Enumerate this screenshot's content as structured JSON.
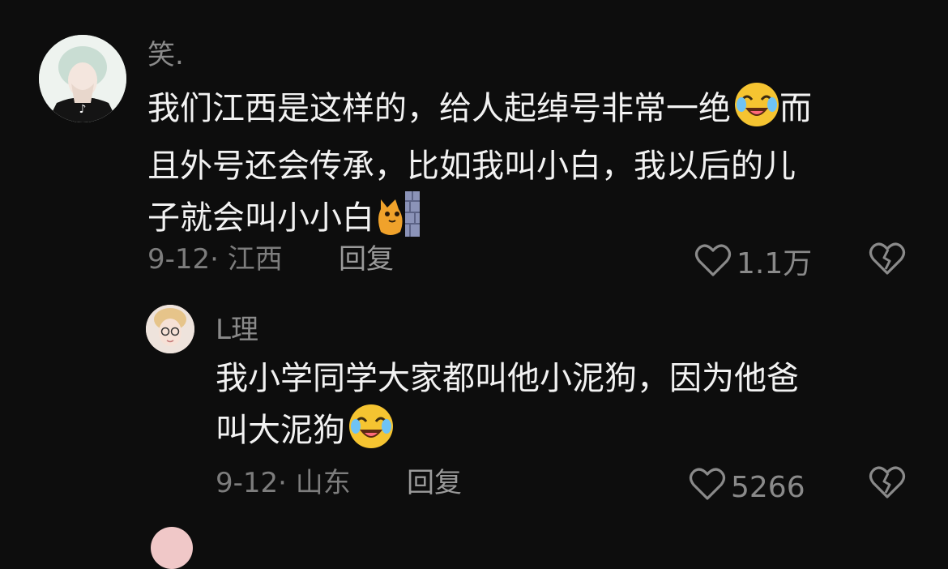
{
  "comments": [
    {
      "author": "笑.",
      "text_lines": [
        "我们江西是这样的，给人起绰号非常一绝",
        "而",
        "且外号还会传承，比如我叫小白，我以后的儿",
        "子就会叫小小白"
      ],
      "date": "9-12",
      "location": "江西",
      "reply_label": "回复",
      "likes": "1.1万",
      "emoji_1": "crying-laughing-emoji",
      "emoji_2": "cat-peeking-wall-sticker"
    }
  ],
  "replies": [
    {
      "author": "L理",
      "text_lines": [
        "我小学同学大家都叫他小泥狗，因为他爸",
        "叫大泥狗"
      ],
      "date": "9-12",
      "location": "山东",
      "reply_label": "回复",
      "likes": "5266",
      "emoji_1": "crying-laughing-emoji"
    }
  ],
  "colors": {
    "background": "#0d0d0d",
    "primary_text": "#f2f2f2",
    "secondary_text": "#8a8a8a",
    "emoji_yellow": "#f5c431"
  },
  "icons": [
    "heart-outline-icon",
    "broken-heart-icon"
  ]
}
